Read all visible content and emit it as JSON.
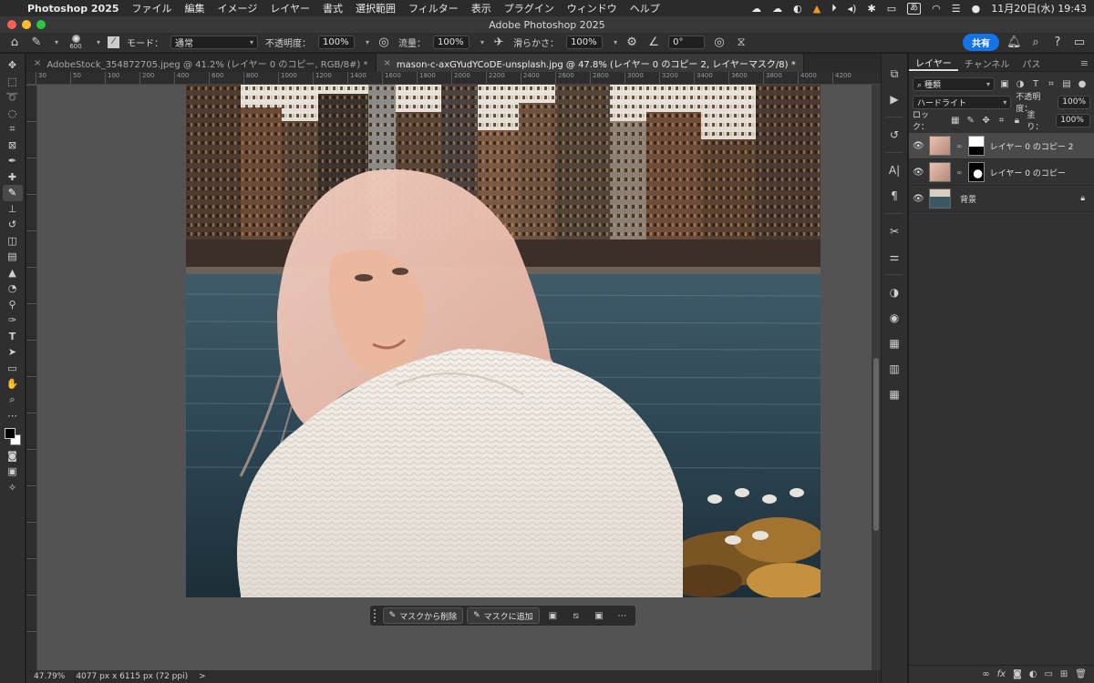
{
  "menubar": {
    "app": "Photoshop 2025",
    "items": [
      "ファイル",
      "編集",
      "イメージ",
      "レイヤー",
      "書式",
      "選択範囲",
      "フィルター",
      "表示",
      "プラグイン",
      "ウィンドウ",
      "ヘルプ"
    ],
    "ime": "あ",
    "clock": "11月20日(水) 19:43"
  },
  "titlebar": {
    "title": "Adobe Photoshop 2025"
  },
  "options": {
    "brush_size": "600",
    "mode_label": "モード：",
    "mode_value": "通常",
    "opacity_label": "不透明度：",
    "opacity_value": "100%",
    "flow_label": "流量：",
    "flow_value": "100%",
    "smoothing_label": "滑らかさ：",
    "smoothing_value": "100%",
    "angle_value": "0°",
    "share_label": "共有"
  },
  "doc_tabs": [
    {
      "label": "AdobeStock_354872705.jpeg @ 41.2% (レイヤー 0 のコピー, RGB/8#) *"
    },
    {
      "label": "mason-c-axGYudYCoDE-unsplash.jpg @ 47.8% (レイヤー 0 のコピー 2, レイヤーマスク/8) *"
    }
  ],
  "ruler_top": [
    "30",
    "50",
    "100",
    "200",
    "400",
    "600",
    "800",
    "1000",
    "1200",
    "1400",
    "1600",
    "1800",
    "2000",
    "2200",
    "2400",
    "2600",
    "2800",
    "3000",
    "3200",
    "3400",
    "3600",
    "3800",
    "4000",
    "4200"
  ],
  "taskbar": {
    "subtract_label": "マスクから削除",
    "add_label": "マスクに追加"
  },
  "status": {
    "zoom": "47.79%",
    "dims": "4077 px x 6115 px (72 ppi)",
    "arrow": ">"
  },
  "panel": {
    "tabs": [
      "レイヤー",
      "チャンネル",
      "パス"
    ],
    "filter_value": "種類",
    "blend_value": "ハードライト",
    "opacity_label": "不透明度：",
    "opacity_value": "100%",
    "lock_label": "ロック：",
    "fill_label": "塗り：",
    "fill_value": "100%",
    "layers": [
      {
        "name": "レイヤー 0 のコピー 2",
        "selected": true
      },
      {
        "name": "レイヤー 0 のコピー",
        "selected": false
      },
      {
        "name": "背景",
        "selected": false
      }
    ]
  }
}
